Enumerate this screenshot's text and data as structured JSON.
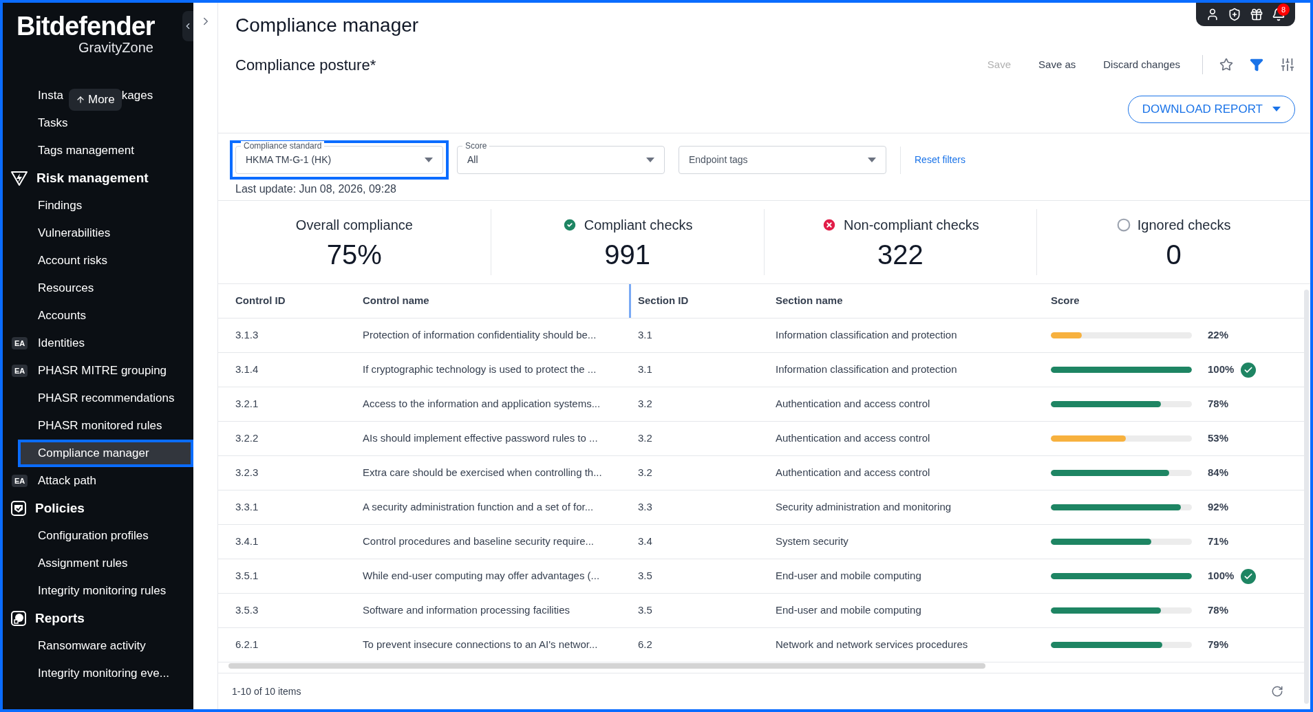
{
  "sidebar": {
    "logo": "Bitdefender",
    "logo_sub": "GravityZone",
    "more_button": "More",
    "items": [
      {
        "kind": "item",
        "label_parts": [
          "Insta",
          "kages"
        ],
        "selected": false,
        "highlighted": false
      },
      {
        "kind": "item",
        "label": "Tasks",
        "selected": false,
        "highlighted": false
      },
      {
        "kind": "item",
        "label": "Tags management",
        "selected": false,
        "highlighted": false
      },
      {
        "kind": "section",
        "label": "Risk management"
      },
      {
        "kind": "item",
        "label": "Findings",
        "selected": false,
        "highlighted": false
      },
      {
        "kind": "item",
        "label": "Vulnerabilities",
        "selected": false,
        "highlighted": false
      },
      {
        "kind": "item",
        "label": "Account risks",
        "selected": false,
        "highlighted": false
      },
      {
        "kind": "item",
        "label": "Resources",
        "selected": false,
        "highlighted": false
      },
      {
        "kind": "item",
        "label": "Accounts",
        "selected": false,
        "highlighted": false
      },
      {
        "kind": "item",
        "label": "Identities",
        "badge": "EA",
        "selected": false,
        "highlighted": false
      },
      {
        "kind": "item",
        "label": "PHASR MITRE grouping",
        "badge": "EA",
        "selected": false,
        "highlighted": false
      },
      {
        "kind": "item",
        "label": "PHASR recommendations",
        "selected": false,
        "highlighted": false
      },
      {
        "kind": "item",
        "label": "PHASR monitored rules",
        "selected": false,
        "highlighted": false
      },
      {
        "kind": "item",
        "label": "Compliance manager",
        "selected": true,
        "highlighted": true
      },
      {
        "kind": "item",
        "label": "Attack path",
        "badge": "EA",
        "selected": false,
        "highlighted": false
      },
      {
        "kind": "section",
        "label": "Policies"
      },
      {
        "kind": "item",
        "label": "Configuration profiles",
        "selected": false,
        "highlighted": false
      },
      {
        "kind": "item",
        "label": "Assignment rules",
        "selected": false,
        "highlighted": false
      },
      {
        "kind": "item",
        "label": "Integrity monitoring rules",
        "selected": false,
        "highlighted": false
      },
      {
        "kind": "section",
        "label": "Reports"
      },
      {
        "kind": "item",
        "label": "Ransomware activity",
        "selected": false,
        "highlighted": false
      },
      {
        "kind": "item",
        "label": "Integrity monitoring eve...",
        "selected": false,
        "highlighted": false
      }
    ]
  },
  "header": {
    "title": "Compliance manager",
    "notifications": "8"
  },
  "view": {
    "name": "Compliance posture*",
    "actions": [
      {
        "label": "Save",
        "disabled": true
      },
      {
        "label": "Save as",
        "disabled": false
      },
      {
        "label": "Discard changes",
        "disabled": false
      }
    ],
    "download": "DOWNLOAD REPORT"
  },
  "filters": [
    {
      "label": "Compliance standard",
      "value": "HKMA TM-G-1 (HK)",
      "highlighted": true
    },
    {
      "label": "Score",
      "value": "All",
      "highlighted": false
    },
    {
      "placeholder": "Endpoint tags",
      "highlighted": false
    }
  ],
  "reset_filters": "Reset filters",
  "last_update": "Last update: Jun 08, 2026, 09:28",
  "stats": [
    {
      "kind": "overall",
      "label": "Overall compliance",
      "value": "75%"
    },
    {
      "kind": "compliant",
      "label": "Compliant checks",
      "value": "991"
    },
    {
      "kind": "noncompliant",
      "label": "Non-compliant checks",
      "value": "322"
    },
    {
      "kind": "ignored",
      "label": "Ignored checks",
      "value": "0"
    }
  ],
  "table": {
    "columns": [
      "Control ID",
      "Control name",
      "Section ID",
      "Section name",
      "Score"
    ],
    "rows": [
      {
        "control_id": "3.1.3",
        "control_name": "Protection of information confidentiality should be...",
        "section_id": "3.1",
        "section_name": "Information classification and protection",
        "level": 0.22,
        "score": "22%",
        "color": "#f7b13e",
        "passed": false
      },
      {
        "control_id": "3.1.4",
        "control_name": "If cryptographic technology is used to protect the ...",
        "section_id": "3.1",
        "section_name": "Information classification and protection",
        "level": 1,
        "score": "100%",
        "color": "#1e8563",
        "passed": true
      },
      {
        "control_id": "3.2.1",
        "control_name": "Access to the information and application systems...",
        "section_id": "3.2",
        "section_name": "Authentication and access control",
        "level": 0.78,
        "score": "78%",
        "color": "#1e8563",
        "passed": false
      },
      {
        "control_id": "3.2.2",
        "control_name": "AIs should implement effective password rules to ...",
        "section_id": "3.2",
        "section_name": "Authentication and access control",
        "level": 0.53,
        "score": "53%",
        "color": "#f7b13e",
        "passed": false
      },
      {
        "control_id": "3.2.3",
        "control_name": "Extra care should be exercised when controlling th...",
        "section_id": "3.2",
        "section_name": "Authentication and access control",
        "level": 0.84,
        "score": "84%",
        "color": "#1e8563",
        "passed": false
      },
      {
        "control_id": "3.3.1",
        "control_name": "A security administration function and a set of for...",
        "section_id": "3.3",
        "section_name": "Security administration and monitoring",
        "level": 0.92,
        "score": "92%",
        "color": "#1e8563",
        "passed": false
      },
      {
        "control_id": "3.4.1",
        "control_name": "Control procedures and baseline security require...",
        "section_id": "3.4",
        "section_name": "System security",
        "level": 0.71,
        "score": "71%",
        "color": "#1e8563",
        "passed": false
      },
      {
        "control_id": "3.5.1",
        "control_name": "While end-user computing may offer advantages (...",
        "section_id": "3.5",
        "section_name": "End-user and mobile computing",
        "level": 1,
        "score": "100%",
        "color": "#1e8563",
        "passed": true
      },
      {
        "control_id": "3.5.3",
        "control_name": "Software and information processing facilities",
        "section_id": "3.5",
        "section_name": "End-user and mobile computing",
        "level": 0.78,
        "score": "78%",
        "color": "#1e8563",
        "passed": false
      },
      {
        "control_id": "6.2.1",
        "control_name": "To prevent insecure connections to an AI's networ...",
        "section_id": "6.2",
        "section_name": "Network and network services procedures",
        "level": 0.79,
        "score": "79%",
        "color": "#1e8563",
        "passed": false
      }
    ]
  },
  "pagination": "1-10 of 10 items"
}
